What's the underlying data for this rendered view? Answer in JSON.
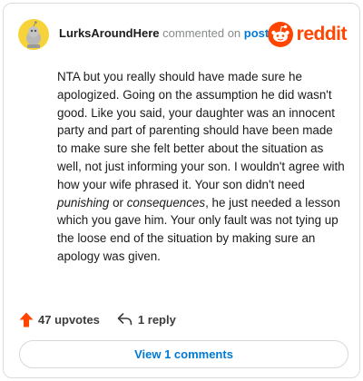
{
  "comment": {
    "username": "LurksAroundHere",
    "action_text": "commented on",
    "post_link": "post",
    "body": {
      "part1": "NTA but you really should have made sure he apologized. Going on the assumption he did wasn't good. Like you said, your daughter was an innocent party and part of parenting should have been made to make sure she felt better about the situation as well, not just informing your son. I wouldn't agree with how your wife phrased it. Your son didn't need ",
      "em1": "punishing",
      "part2": " or ",
      "em2": "consequences",
      "part3": ", he just needed a lesson which you gave him. Your only fault was not tying up the loose end of the situation by making sure an apology was given."
    }
  },
  "brand": {
    "name": "reddit",
    "icon": "reddit-snoo-icon",
    "color": "#ff4500"
  },
  "actions": {
    "upvotes": "47 upvotes",
    "upvote_icon": "upvote-arrow-icon",
    "replies": "1 reply",
    "reply_icon": "reply-arrow-icon"
  },
  "footer": {
    "view_comments": "View 1 comments"
  },
  "colors": {
    "accent_blue": "#0079d3",
    "upvote_orange": "#ff4500",
    "avatar_bg": "#f7d33a"
  }
}
